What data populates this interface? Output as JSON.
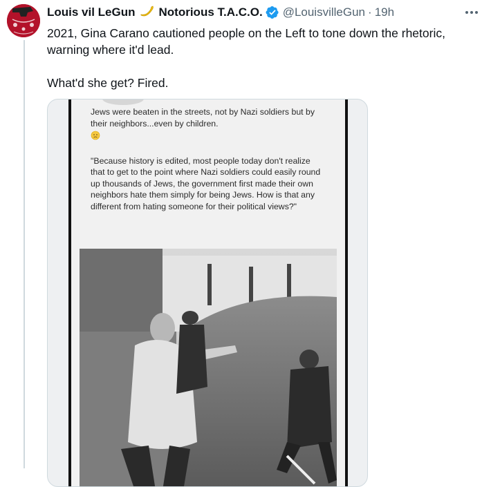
{
  "tweet": {
    "display_name": "Louis vil LeGun",
    "display_name_suffix": "Notorious T.A.C.O.",
    "emoji_icon": "banana-icon",
    "handle": "@LouisvilleGun",
    "separator": "·",
    "timestamp": "19h",
    "more_icon": "more-horizontal-icon",
    "text_paragraphs": [
      "2021, Gina Carano cautioned people on the Left to tone down the rhetoric, warning where it'd lead.",
      "What'd she get? Fired."
    ]
  },
  "media": {
    "screenshot_text": {
      "line1": "Jews were beaten in the streets, not by Nazi soldiers but by their neighbors...even by children.",
      "emoji_icon": "sad-face-icon",
      "quote": "\"Because history is edited, most people today don't realize that to get to the point where Nazi soldiers could easily round up thousands of Jews, the government first made their own neighbors hate them simply for being Jews. How is that any different from hating someone for their political views?\""
    }
  },
  "colors": {
    "text_primary": "#0f1419",
    "text_secondary": "#536471",
    "verified_blue": "#1d9bf0",
    "border": "#cfd9de",
    "avatar_red": "#b3122a"
  }
}
